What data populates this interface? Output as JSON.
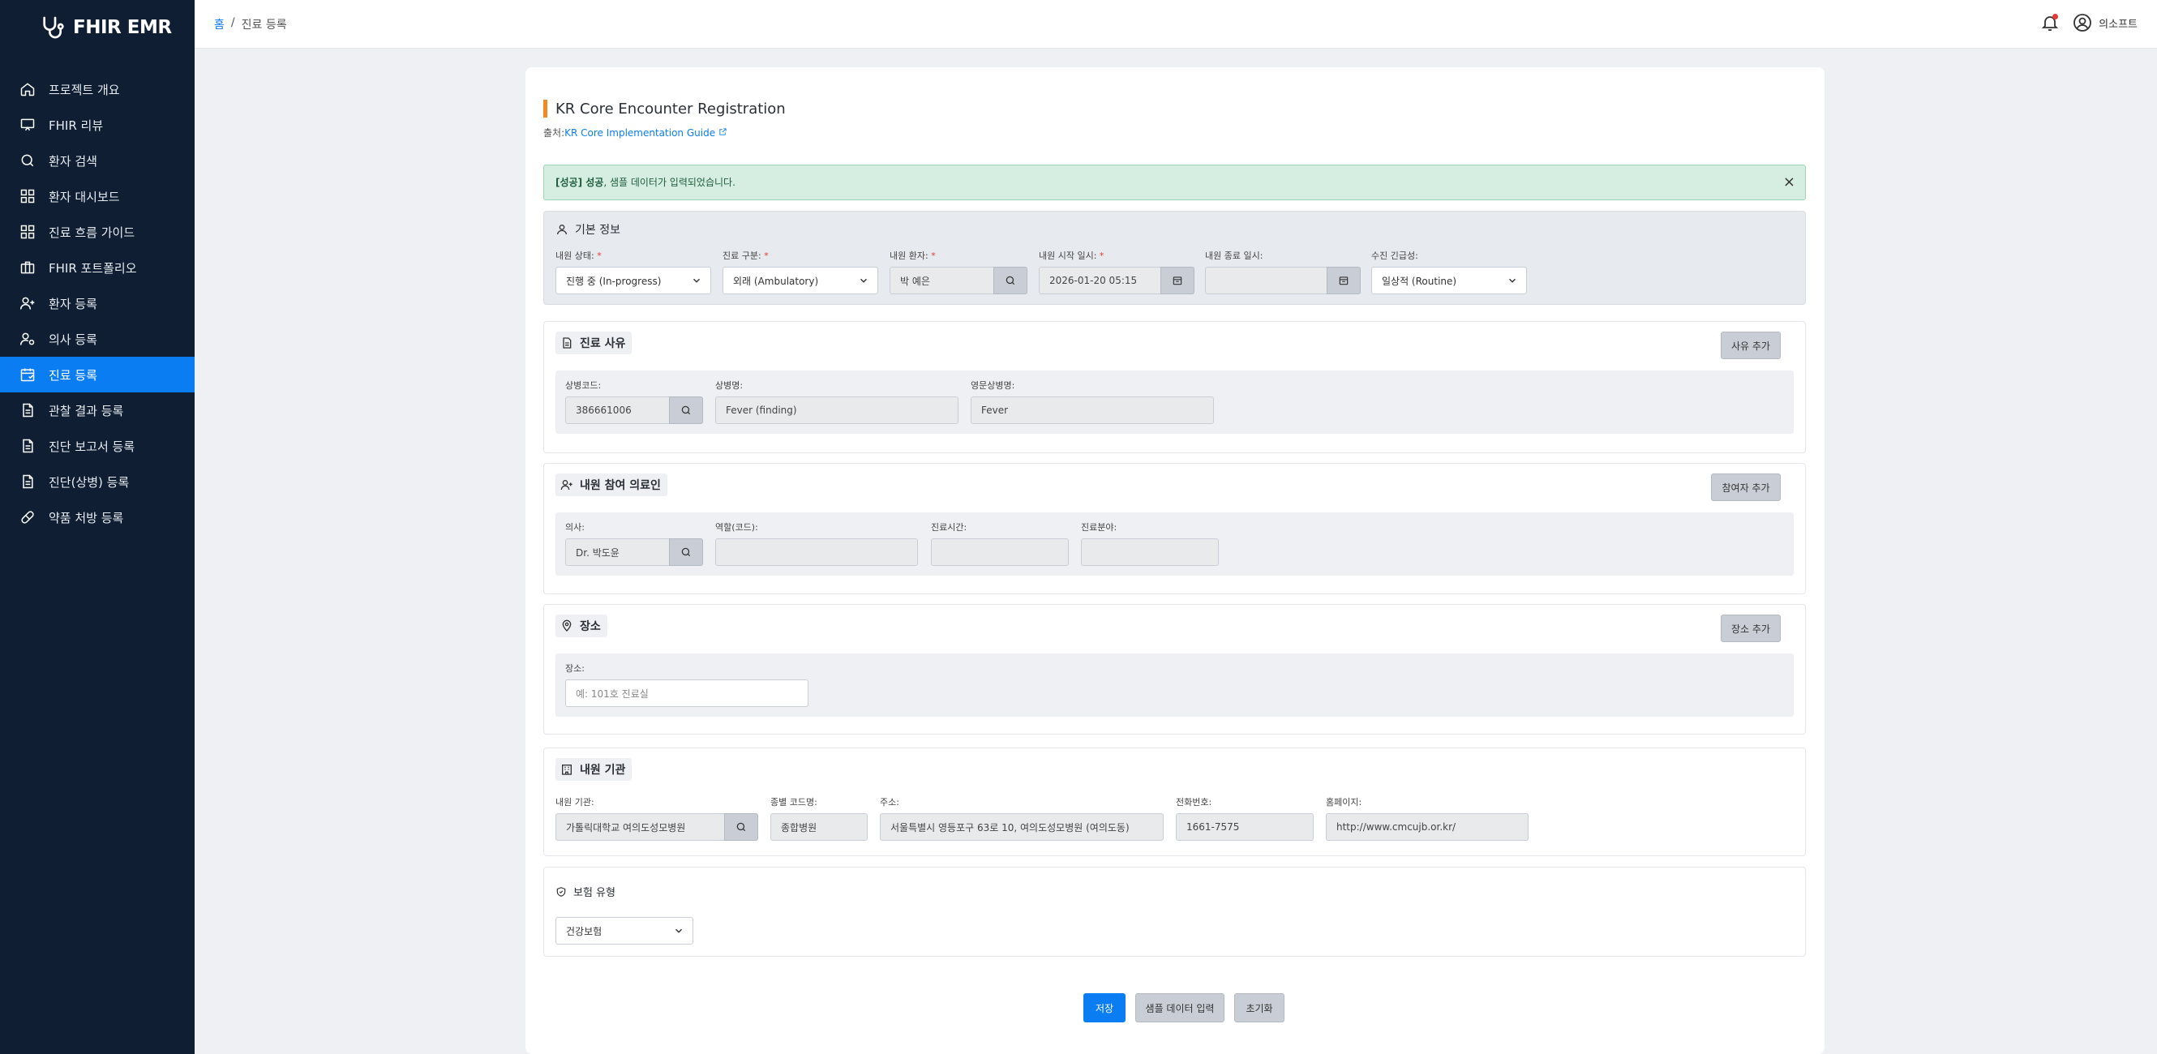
{
  "app": {
    "name": "FHIR EMR"
  },
  "sidebar": {
    "items": [
      {
        "label": "프로젝트 개요",
        "icon": "home-icon"
      },
      {
        "label": "FHIR 리뷰",
        "icon": "presentation-icon"
      },
      {
        "label": "환자 검색",
        "icon": "search-icon"
      },
      {
        "label": "환자 대시보드",
        "icon": "dashboard-icon"
      },
      {
        "label": "진료 흐름 가이드",
        "icon": "dashboard-icon"
      },
      {
        "label": "FHIR 포트폴리오",
        "icon": "briefcase-icon"
      },
      {
        "label": "환자 등록",
        "icon": "user-plus-icon"
      },
      {
        "label": "의사 등록",
        "icon": "user-gear-icon"
      },
      {
        "label": "진료 등록",
        "icon": "calendar-icon"
      },
      {
        "label": "관찰 결과 등록",
        "icon": "document-icon"
      },
      {
        "label": "진단 보고서 등록",
        "icon": "document-icon"
      },
      {
        "label": "진단(상병) 등록",
        "icon": "document-icon"
      },
      {
        "label": "약품 처방 등록",
        "icon": "pill-icon"
      }
    ],
    "active_index": 8
  },
  "header": {
    "breadcrumb_home": "홈",
    "breadcrumb_sep": "/",
    "breadcrumb_current": "진료 등록",
    "user_name": "의소프트"
  },
  "page": {
    "title": "KR Core Encounter Registration",
    "source_prefix": "출처:",
    "source_link": "KR Core Implementation Guide",
    "alert_bold": "[성공] 성공",
    "alert_text": ", 샘플 데이터가 입력되었습니다.",
    "alert_close": "×"
  },
  "basic": {
    "title": "기본 정보",
    "status_label": "내원 상태: ",
    "status_value": "진행 중 (In-progress)",
    "class_label": "진료 구분: ",
    "class_value": "외래 (Ambulatory)",
    "patient_label": "내원 환자: ",
    "patient_value": "박 예은",
    "start_label": "내원 시작 일시: ",
    "start_value": "2026-01-20 05:15",
    "end_label": "내원 종료 일시:",
    "end_value": "",
    "priority_label": "수진 긴급성:",
    "priority_value": "일상적 (Routine)",
    "required_mark": "*"
  },
  "reason": {
    "title": "진료 사유",
    "add_button": "사유 추가",
    "code_label": "상병코드:",
    "code_value": "386661006",
    "name_label": "상병명:",
    "name_value": "Fever (finding)",
    "eng_label": "영문상병명:",
    "eng_value": "Fever"
  },
  "participant": {
    "title": "내원 참여 의료인",
    "add_button": "참여자 추가",
    "doctor_label": "의사:",
    "doctor_value": "Dr. 박도윤",
    "role_label": "역할(코드):",
    "role_value": "",
    "time_label": "진료시간:",
    "time_value": "",
    "dept_label": "진료분야:",
    "dept_value": ""
  },
  "location": {
    "title": "장소",
    "add_button": "장소 추가",
    "label": "장소:",
    "placeholder": "예: 101호 진료실"
  },
  "org": {
    "title": "내원 기관",
    "name_label": "내원 기관:",
    "name_value": "가톨릭대학교 여의도성모병원",
    "type_label": "종별 코드명:",
    "type_value": "종합병원",
    "addr_label": "주소:",
    "addr_value": "서울특별시 영등포구 63로 10, 여의도성모병원 (여의도동)",
    "phone_label": "전화번호:",
    "phone_value": "1661-7575",
    "web_label": "홈페이지:",
    "web_value": "http://www.cmcujb.or.kr/"
  },
  "insurance": {
    "title": "보험 유형",
    "value": "건강보험"
  },
  "actions": {
    "save": "저장",
    "sample": "샘플 데이터 입력",
    "reset": "초기화"
  },
  "colors": {
    "sidebar_bg": "#0f1e33",
    "accent": "#0b7df2",
    "title_bar": "#f08a24",
    "alert_bg": "#d6eee1"
  }
}
